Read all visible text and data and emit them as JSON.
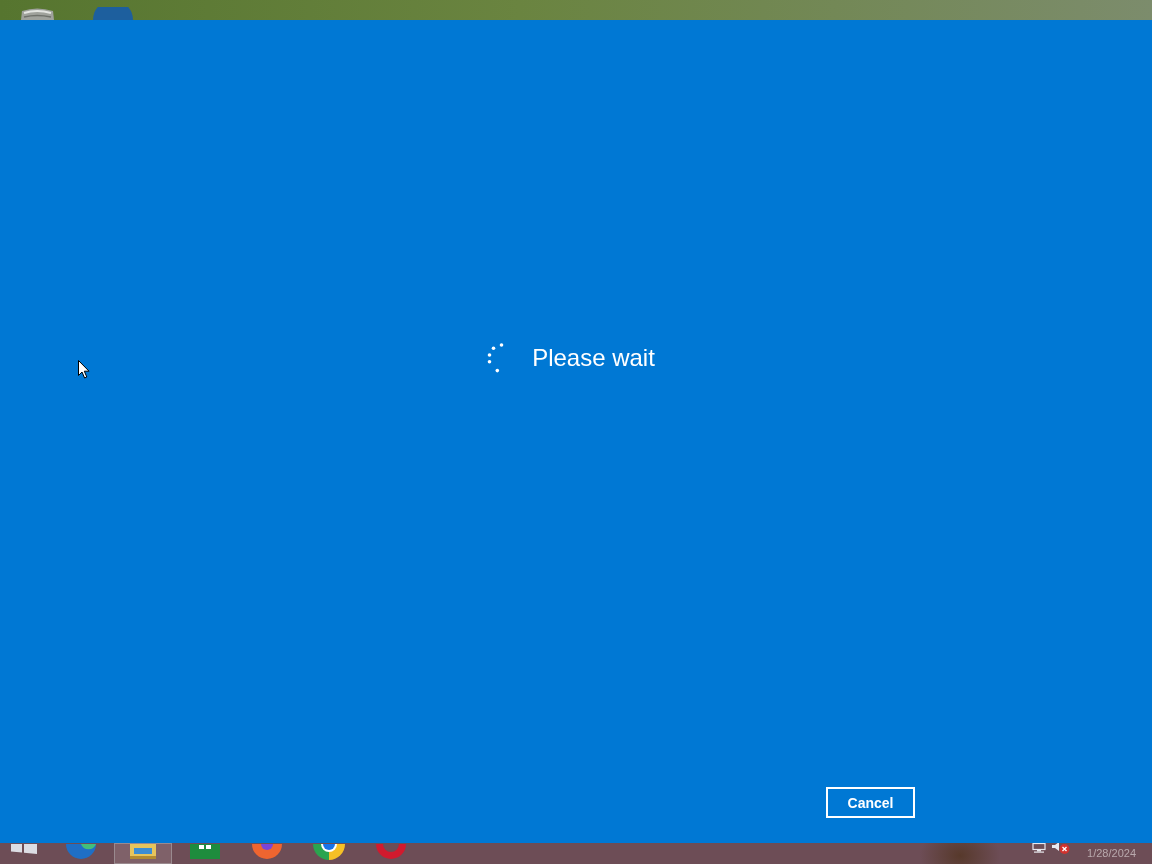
{
  "desktop": {
    "icons": [
      {
        "kind": "bin"
      },
      {
        "kind": "disc"
      }
    ]
  },
  "dialog": {
    "message": "Please wait",
    "cancel_button": "Cancel"
  },
  "taskbar": {
    "items": [
      {
        "kind": "start",
        "selected": false
      },
      {
        "kind": "swirl",
        "selected": false
      },
      {
        "kind": "folder",
        "selected": true
      },
      {
        "kind": "sheet",
        "selected": false
      },
      {
        "kind": "flame",
        "selected": false
      },
      {
        "kind": "wheel",
        "selected": false
      },
      {
        "kind": "ring",
        "selected": false
      }
    ],
    "tray": {
      "volume_muted": true,
      "date": "1/28/2024"
    }
  }
}
